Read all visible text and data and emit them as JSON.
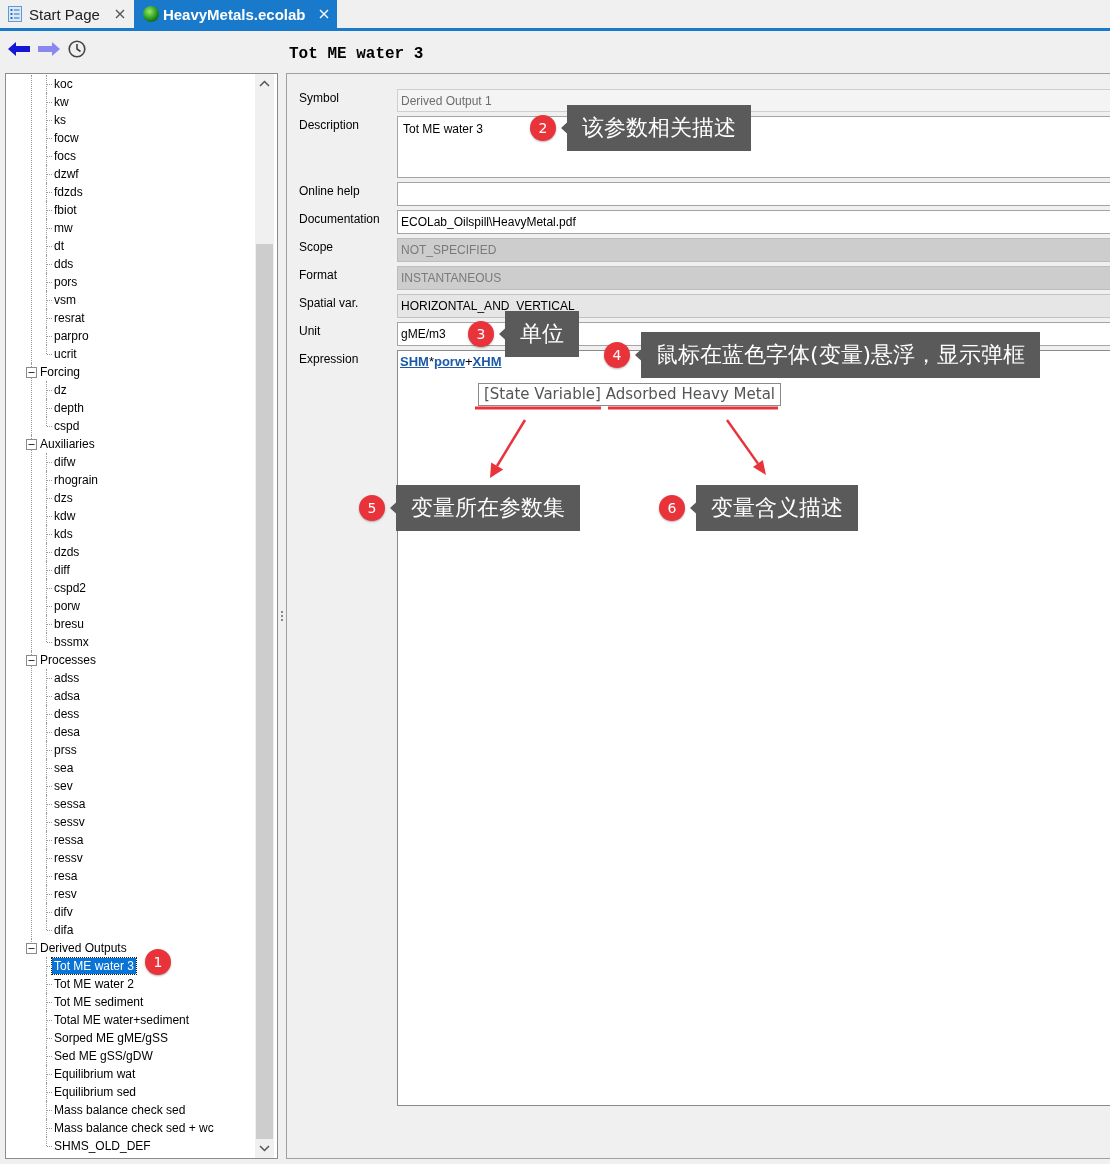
{
  "tabs": [
    {
      "label": "Start Page",
      "kind": "page",
      "selected": false
    },
    {
      "label": "HeavyMetals.ecolab",
      "kind": "model",
      "selected": true
    }
  ],
  "title": "Tot ME water 3",
  "tree": [
    {
      "children": [
        {
          "label": "koc",
          "selected": false
        },
        {
          "label": "kw",
          "selected": false
        },
        {
          "label": "ks",
          "selected": false
        },
        {
          "label": "focw",
          "selected": false
        },
        {
          "label": "focs",
          "selected": false
        },
        {
          "label": "dzwf",
          "selected": false
        },
        {
          "label": "fdzds",
          "selected": false
        },
        {
          "label": "fbiot",
          "selected": false
        },
        {
          "label": "mw",
          "selected": false
        },
        {
          "label": "dt",
          "selected": false
        },
        {
          "label": "dds",
          "selected": false
        },
        {
          "label": "pors",
          "selected": false
        },
        {
          "label": "vsm",
          "selected": false
        },
        {
          "label": "resrat",
          "selected": false
        },
        {
          "label": "parpro",
          "selected": false
        },
        {
          "label": "ucrit",
          "selected": false
        }
      ]
    },
    {
      "label": "Forcing",
      "expanded": true,
      "children": [
        {
          "label": "dz",
          "selected": false
        },
        {
          "label": "depth",
          "selected": false
        },
        {
          "label": "cspd",
          "selected": false
        }
      ]
    },
    {
      "label": "Auxiliaries",
      "expanded": true,
      "children": [
        {
          "label": "difw",
          "selected": false
        },
        {
          "label": "rhograin",
          "selected": false
        },
        {
          "label": "dzs",
          "selected": false
        },
        {
          "label": "kdw",
          "selected": false
        },
        {
          "label": "kds",
          "selected": false
        },
        {
          "label": "dzds",
          "selected": false
        },
        {
          "label": "diff",
          "selected": false
        },
        {
          "label": "cspd2",
          "selected": false
        },
        {
          "label": "porw",
          "selected": false
        },
        {
          "label": "bresu",
          "selected": false
        },
        {
          "label": "bssmx",
          "selected": false
        }
      ]
    },
    {
      "label": "Processes",
      "expanded": true,
      "children": [
        {
          "label": "adss",
          "selected": false
        },
        {
          "label": "adsa",
          "selected": false
        },
        {
          "label": "dess",
          "selected": false
        },
        {
          "label": "desa",
          "selected": false
        },
        {
          "label": "prss",
          "selected": false
        },
        {
          "label": "sea",
          "selected": false
        },
        {
          "label": "sev",
          "selected": false
        },
        {
          "label": "sessa",
          "selected": false
        },
        {
          "label": "sessv",
          "selected": false
        },
        {
          "label": "ressa",
          "selected": false
        },
        {
          "label": "ressv",
          "selected": false
        },
        {
          "label": "resa",
          "selected": false
        },
        {
          "label": "resv",
          "selected": false
        },
        {
          "label": "difv",
          "selected": false
        },
        {
          "label": "difa",
          "selected": false
        }
      ]
    },
    {
      "label": "Derived Outputs",
      "expanded": true,
      "children": [
        {
          "label": "Tot ME water 3",
          "selected": true
        },
        {
          "label": "Tot ME water 2",
          "selected": false
        },
        {
          "label": "Tot ME sediment",
          "selected": false
        },
        {
          "label": "Total ME water+sediment",
          "selected": false
        },
        {
          "label": "Sorped ME gME/gSS",
          "selected": false
        },
        {
          "label": "Sed ME gSS/gDW",
          "selected": false
        },
        {
          "label": "Equilibrium wat",
          "selected": false
        },
        {
          "label": "Equilibrium sed",
          "selected": false
        },
        {
          "label": "Mass balance check sed",
          "selected": false
        },
        {
          "label": "Mass balance check sed + wc",
          "selected": false
        },
        {
          "label": "SHMS_OLD_DEF",
          "selected": false
        }
      ]
    }
  ],
  "form": {
    "fields": [
      {
        "label": "Symbol",
        "kind": "readonly",
        "value": "Derived Output 1"
      },
      {
        "label": "Description",
        "kind": "multiline",
        "value": "Tot ME water 3"
      },
      {
        "label": "Online help",
        "kind": "text"
      },
      {
        "label": "Documentation",
        "kind": "text",
        "value": "ECOLab_Oilspill\\HeavyMetal.pdf"
      },
      {
        "label": "Scope",
        "kind": "disabled",
        "value": "NOT_SPECIFIED"
      },
      {
        "label": "Format",
        "kind": "disabled",
        "value": "INSTANTANEOUS"
      },
      {
        "label": "Spatial var.",
        "kind": "choice",
        "value": "HORIZONTAL_AND_VERTICAL"
      },
      {
        "label": "Unit",
        "kind": "text",
        "value": "gME/m3"
      },
      {
        "label": "Expression",
        "kind": "expression",
        "tokens": [
          {
            "text": "SHM",
            "kind": "variable"
          },
          {
            "text": "*",
            "kind": "operator"
          },
          {
            "text": "porw",
            "kind": "variable"
          },
          {
            "text": "+",
            "kind": "operator"
          },
          {
            "text": "XHM",
            "kind": "variable"
          }
        ],
        "tooltip": "[State Variable] Adsorbed Heavy Metal"
      }
    ]
  },
  "annotations": [
    {
      "number": "1"
    },
    {
      "number": "2",
      "text": "该参数相关描述"
    },
    {
      "number": "3",
      "text": "单位"
    },
    {
      "number": "4",
      "text": "鼠标在蓝色字体(变量)悬浮，显示弹框"
    },
    {
      "number": "5",
      "text": "变量所在参数集"
    },
    {
      "number": "6",
      "text": "变量含义描述"
    }
  ]
}
